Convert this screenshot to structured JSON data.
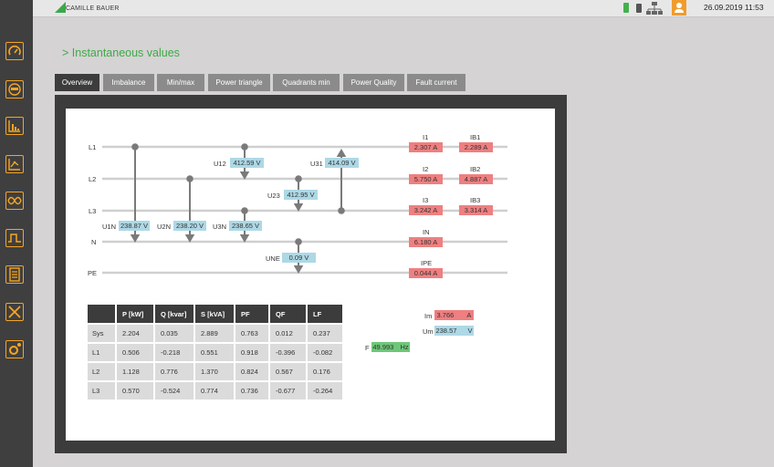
{
  "brand": {
    "name": "CAMILLE BAUER"
  },
  "status": {
    "datetime": "26.09.2019  11:53"
  },
  "page": {
    "title": "> Instantaneous values"
  },
  "tabs": [
    {
      "label": "Overview"
    },
    {
      "label": "Imbalance"
    },
    {
      "label": "Min/max"
    },
    {
      "label": "Power triangle"
    },
    {
      "label": "Quadrants min"
    },
    {
      "label": "Power Quality"
    },
    {
      "label": "Fault current"
    }
  ],
  "lines": {
    "l1": "L1",
    "l2": "L2",
    "l3": "L3",
    "n": "N",
    "pe": "PE"
  },
  "voltages": {
    "u12": {
      "label": "U12",
      "value": "412.59 V"
    },
    "u31": {
      "label": "U31",
      "value": "414.09 V"
    },
    "u23": {
      "label": "U23",
      "value": "412.95 V"
    },
    "u1n": {
      "label": "U1N",
      "value": "238.87 V"
    },
    "u2n": {
      "label": "U2N",
      "value": "238.20 V"
    },
    "u3n": {
      "label": "U3N",
      "value": "238.65 V"
    },
    "une": {
      "label": "UNE",
      "value": "0.09 V"
    }
  },
  "currents": {
    "i1": {
      "label": "I1",
      "value": "2.307 A"
    },
    "ib1": {
      "label": "IB1",
      "value": "2.289 A"
    },
    "i2": {
      "label": "I2",
      "value": "5.750 A"
    },
    "ib2": {
      "label": "IB2",
      "value": "4.887 A"
    },
    "i3": {
      "label": "I3",
      "value": "3.242 A"
    },
    "ib3": {
      "label": "IB3",
      "value": "3.314 A"
    },
    "in": {
      "label": "IN",
      "value": "6.180 A"
    },
    "ipe": {
      "label": "IPE",
      "value": "0.044 A"
    }
  },
  "table": {
    "headers": [
      "",
      "P [kW]",
      "Q [kvar]",
      "S [kVA]",
      "PF",
      "QF",
      "LF"
    ],
    "rows": [
      [
        "Sys",
        "2.204",
        "0.035",
        "2.889",
        "0.763",
        "0.012",
        "0.237"
      ],
      [
        "L1",
        "0.506",
        "-0.218",
        "0.551",
        "0.918",
        "-0.396",
        "-0.082"
      ],
      [
        "L2",
        "1.128",
        "0.776",
        "1.370",
        "0.824",
        "0.567",
        "0.176"
      ],
      [
        "L3",
        "0.570",
        "-0.524",
        "0.774",
        "0.736",
        "-0.677",
        "-0.264"
      ]
    ]
  },
  "averages": {
    "im": {
      "label": "Im",
      "value": "3.766",
      "unit": "A"
    },
    "um": {
      "label": "Um",
      "value": "238.57",
      "unit": "V"
    },
    "f": {
      "label": "F",
      "value": "49.993",
      "unit": "Hz"
    }
  },
  "colors": {
    "accent": "#f5a623",
    "title_green": "#3eaa48",
    "current_red": "#ef7f80",
    "voltage_blue": "#add8e6",
    "freq_green": "#6ec779"
  }
}
